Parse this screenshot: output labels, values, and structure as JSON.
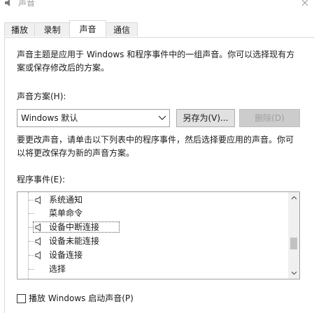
{
  "window": {
    "title": "声音"
  },
  "tabs": [
    {
      "label": "播放"
    },
    {
      "label": "录制"
    },
    {
      "label": "声音"
    },
    {
      "label": "通信"
    }
  ],
  "sounds_tab": {
    "description_line1": "声音主题是应用于 Windows 和程序事件中的一组声音。你可以选择现有方",
    "description_line2": "案或保存修改后的方案。",
    "scheme_label": "声音方案(H):",
    "scheme_selected": "Windows 默认",
    "save_as_button": "另存为(V)...",
    "delete_button": "删除(D)",
    "instruction_line1": "要更改声音，请单击以下列表中的程序事件，然后选择要应用的声音。你可",
    "instruction_line2": "以将更改保存为新的声音方案。",
    "events_label": "程序事件(E):",
    "events": [
      {
        "label": "系统通知",
        "has_sound": true,
        "selected": false
      },
      {
        "label": "菜单命令",
        "has_sound": false,
        "selected": false
      },
      {
        "label": "设备中断连接",
        "has_sound": true,
        "selected": true
      },
      {
        "label": "设备未能连接",
        "has_sound": true,
        "selected": false
      },
      {
        "label": "设备连接",
        "has_sound": true,
        "selected": false
      },
      {
        "label": "选择",
        "has_sound": false,
        "selected": false
      }
    ],
    "startup_checkbox_label": "播放 Windows 启动声音(P)",
    "startup_checkbox_checked": false
  },
  "colors": {
    "accent": "#0078d7",
    "border": "#a0a0a0",
    "disabled_text": "#a0a0a0"
  }
}
